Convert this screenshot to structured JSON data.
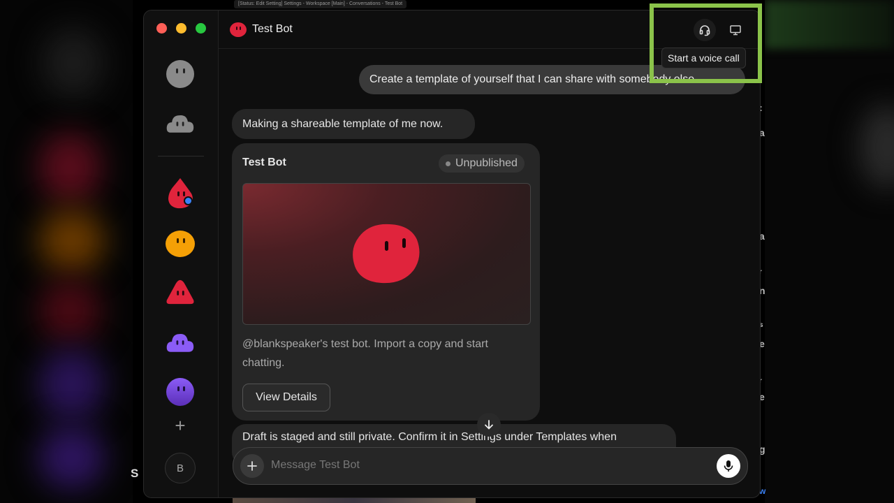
{
  "background": {
    "top_crumb": "[Status: Edit Setting] Settings - Workspace [Main] - Conversations - Test Bot",
    "stray_letter": "S",
    "right_fragments": [
      ":",
      "a",
      "a",
      "r",
      "n",
      "s",
      "e",
      "r",
      "e",
      "g",
      "w"
    ]
  },
  "window": {
    "title": "Test Bot",
    "tooltip": "Start a voice call"
  },
  "sidebar": {
    "user_initial": "B",
    "bots": [
      {
        "name": "gray round",
        "color": "#8a8a8a"
      },
      {
        "name": "gray cloud",
        "color": "#8a8a8a"
      },
      {
        "name": "red drop",
        "color": "#e0243c"
      },
      {
        "name": "orange round",
        "color": "#f5a006"
      },
      {
        "name": "red triangle",
        "color": "#e0243c"
      },
      {
        "name": "purple cloud",
        "color": "#8b5cf6"
      },
      {
        "name": "purple round",
        "color": "#7c4ddb"
      }
    ]
  },
  "chat": {
    "user_message": "Create a template of yourself that I can share with somebody else",
    "bot_message_1": "Making a shareable template of me now.",
    "card": {
      "title": "Test Bot",
      "badge": "Unpublished",
      "description": "@blankspeaker's test bot. Import a copy and start chatting.",
      "button": "View Details"
    },
    "bot_message_2": "Draft is staged and still private. Confirm it in Settings under Templates when"
  },
  "composer": {
    "placeholder": "Message Test Bot"
  },
  "colors": {
    "accent_red": "#e0243c",
    "highlight": "#8bc34a"
  }
}
